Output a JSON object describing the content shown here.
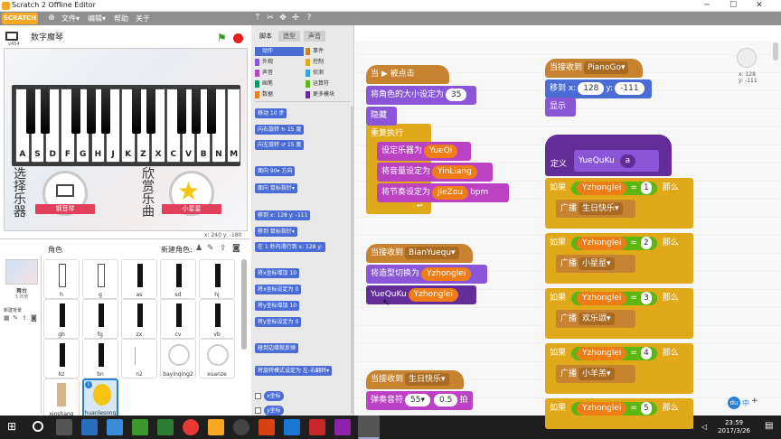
{
  "window": {
    "title": "Scratch 2 Offline Editor"
  },
  "menubar": {
    "logo": "SCRATCH",
    "items": [
      "文件▾",
      "编辑▾",
      "帮助",
      "关于"
    ]
  },
  "stage": {
    "title": "数字魔琴",
    "version": "v454",
    "keys": [
      "A",
      "S",
      "D",
      "F",
      "G",
      "H",
      "J",
      "K",
      "Z",
      "X",
      "C",
      "V",
      "B",
      "N",
      "M"
    ],
    "left_label": [
      "选",
      "择",
      "乐",
      "器"
    ],
    "right_label": [
      "欣",
      "赏",
      "乐",
      "曲"
    ],
    "left_ribbon": "钢音琴",
    "right_ribbon": "小星星",
    "coords": "x: 240  y: -180"
  },
  "sprites_pane": {
    "header": "角色",
    "new_sprite": "新建角色:",
    "stage_label": "舞台",
    "stage_sub": "3 背景",
    "new_backdrop": "新建背景",
    "items": [
      "h",
      "g",
      "as",
      "sd",
      "hj",
      "gh",
      "fg",
      "zx",
      "cv",
      "vb",
      "kz",
      "bn",
      "n2",
      "bayinqing2",
      "xuanze",
      "xinshang",
      "huanlesong"
    ]
  },
  "palette": {
    "tabs": [
      "脚本",
      "造型",
      "声音"
    ],
    "categories": [
      {
        "name": "动作",
        "color": "#4a6cd4"
      },
      {
        "name": "事件",
        "color": "#c88330"
      },
      {
        "name": "外观",
        "color": "#8a55d7"
      },
      {
        "name": "控制",
        "color": "#e1a91a"
      },
      {
        "name": "声音",
        "color": "#bb42c3"
      },
      {
        "name": "侦测",
        "color": "#2ca5e2"
      },
      {
        "name": "画笔",
        "color": "#0e9a6c"
      },
      {
        "name": "运算符",
        "color": "#5cb712"
      },
      {
        "name": "数据",
        "color": "#ee7d16"
      },
      {
        "name": "更多模块",
        "color": "#632d99"
      }
    ],
    "blocks": [
      "移动 10 步",
      "向右旋转 ↻ 15 度",
      "向左旋转 ↺ 15 度",
      "面向 90▾ 方向",
      "面向 鼠标指针▾",
      "移到 x: 128 y: -111",
      "移到 鼠标指针▾",
      "在 1 秒内滑行到 x: 128 y:",
      "将x坐标增加 10",
      "将x坐标设定为 0",
      "将y坐标增加 10",
      "将y坐标设定为 0",
      "碰到边缘就反弹",
      "将旋转模式设定为 左-右翻转▾",
      "x坐标",
      "y坐标"
    ]
  },
  "scripts": {
    "when_flag": "当 ▶ 被点击",
    "set_size": "将角色的大小设定为",
    "set_size_val": "35",
    "hide": "隐藏",
    "forever": "重复执行",
    "set_instrument": "设定乐器为",
    "set_instrument_val": "YueQi",
    "set_volume": "将音量设定为",
    "set_volume_val": "YinLiang",
    "set_tempo": "将节奏设定为",
    "set_tempo_val": "JieZou",
    "bpm": "bpm",
    "recv1": "当接收到",
    "recv1_val": "BianYuequ▾",
    "switch_costume": "将造型切换为",
    "switch_costume_val": "Yzhonglei",
    "call": "YueQuKu",
    "call_val": "Yzhonglei",
    "recv2": "当接收到",
    "recv2_val": "生日快乐▾",
    "play_note": "弹奏音符",
    "play_note_val": "55▾",
    "play_note_beats": "0.5",
    "beats": "拍",
    "recv3": "当接收到",
    "recv3_val": "PianoGo▾",
    "goto": "移到 x:",
    "goto_x": "128",
    "goto_y_label": "y:",
    "goto_y": "-111",
    "show": "显示",
    "define": "定义",
    "define_name": "YueQuKu",
    "define_param": "a",
    "ifs": [
      {
        "label": "如果",
        "var": "Yzhonglei",
        "eq": "=",
        "num": "1",
        "then": "那么",
        "broadcast": "广播",
        "msg": "生日快乐▾"
      },
      {
        "label": "如果",
        "var": "Yzhonglei",
        "eq": "=",
        "num": "2",
        "then": "那么",
        "broadcast": "广播",
        "msg": "小星星▾"
      },
      {
        "label": "如果",
        "var": "Yzhonglei",
        "eq": "=",
        "num": "3",
        "then": "那么",
        "broadcast": "广播",
        "msg": "欢乐颂▾"
      },
      {
        "label": "如果",
        "var": "Yzhonglei",
        "eq": "=",
        "num": "4",
        "then": "那么",
        "broadcast": "广播",
        "msg": "小羊羔▾"
      },
      {
        "label": "如果",
        "var": "Yzhonglei",
        "eq": "=",
        "num": "5",
        "then": "那么",
        "broadcast": "",
        "msg": ""
      }
    ],
    "sprite_coords": "x: 128\ny: -111"
  },
  "taskbar": {
    "time": "23:59",
    "date": "2017/3/26",
    "ime": "中"
  }
}
